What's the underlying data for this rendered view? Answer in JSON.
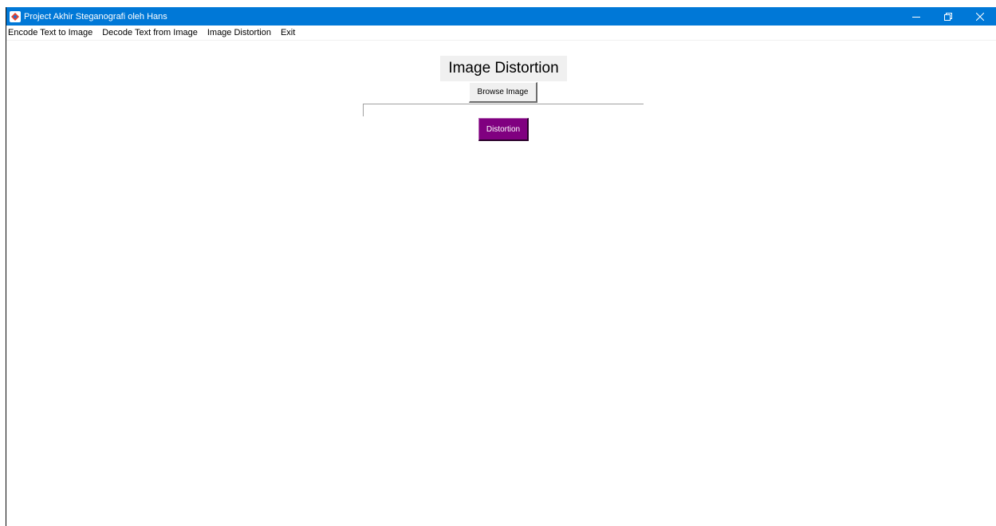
{
  "window": {
    "title": "Project Akhir Steganografi oleh Hans",
    "titlebar_color": "#0078d7",
    "controls": [
      {
        "name": "minimize",
        "icon": "minimize-icon"
      },
      {
        "name": "restore",
        "icon": "restore-icon"
      },
      {
        "name": "close",
        "icon": "close-icon"
      }
    ]
  },
  "menu": {
    "items": [
      "Encode Text to Image",
      "Decode Text from Image",
      "Image Distortion",
      "Exit"
    ]
  },
  "main": {
    "heading": "Image Distortion",
    "browse_label": "Browse Image",
    "file_path": "",
    "distortion_label": "Distortion",
    "distortion_color": "#800080"
  }
}
